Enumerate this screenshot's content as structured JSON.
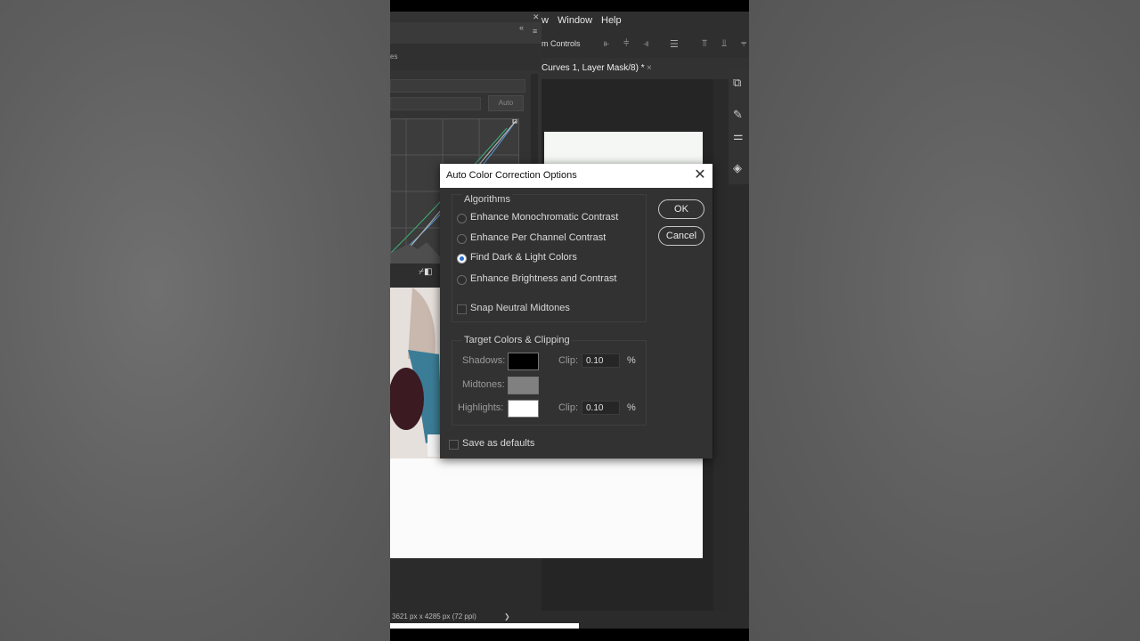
{
  "app": {
    "menu": {
      "partial": "w",
      "window": "Window",
      "help": "Help"
    },
    "options_bar_label": "m Controls",
    "doc_tab_title": "Curves 1, Layer Mask/8) *",
    "doc_tab_close": "×",
    "properties_tab_partial": "es",
    "curves_auto_button": "Auto",
    "status_text": "3621 px x 4285 px (72 ppi)",
    "status_arrow": "❯"
  },
  "dialog": {
    "title": "Auto Color Correction Options",
    "close_glyph": "✕",
    "algorithms": {
      "title": "Algorithms",
      "options": [
        {
          "label": "Enhance Monochromatic Contrast",
          "selected": false
        },
        {
          "label": "Enhance Per Channel Contrast",
          "selected": false
        },
        {
          "label": "Find Dark & Light Colors",
          "selected": true
        },
        {
          "label": "Enhance Brightness and Contrast",
          "selected": false
        }
      ],
      "snap_label": "Snap Neutral Midtones",
      "snap_checked": false
    },
    "targets": {
      "title": "Target Colors & Clipping",
      "shadows_label": "Shadows:",
      "shadows_color": "#000000",
      "midtones_label": "Midtones:",
      "midtones_color": "#808080",
      "highlights_label": "Highlights:",
      "highlights_color": "#ffffff",
      "clip_label": "Clip:",
      "shadows_clip": "0.10",
      "highlights_clip": "0.10",
      "percent": "%"
    },
    "save_defaults_label": "Save as defaults",
    "save_defaults_checked": false,
    "ok_label": "OK",
    "cancel_label": "Cancel"
  }
}
